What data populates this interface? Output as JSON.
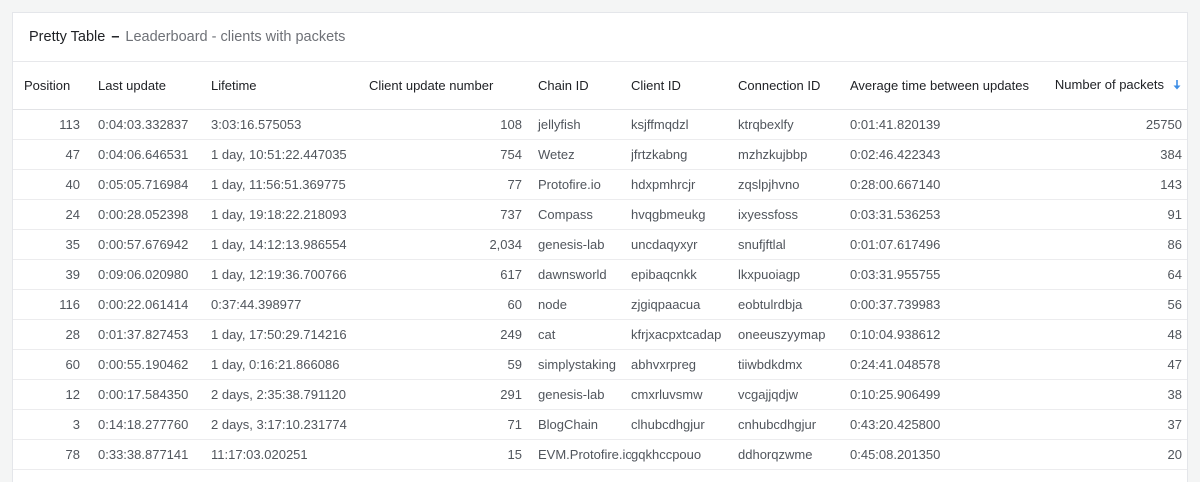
{
  "panel": {
    "title": "Pretty Table",
    "separator": "–",
    "description": "Leaderboard - clients with packets"
  },
  "table": {
    "columns": [
      {
        "key": "position",
        "label": "Position"
      },
      {
        "key": "last_update",
        "label": "Last update"
      },
      {
        "key": "lifetime",
        "label": "Lifetime"
      },
      {
        "key": "client_update_number",
        "label": "Client update number"
      },
      {
        "key": "chain_id",
        "label": "Chain ID"
      },
      {
        "key": "client_id",
        "label": "Client ID"
      },
      {
        "key": "connection_id",
        "label": "Connection ID"
      },
      {
        "key": "avg_time",
        "label": "Average time between updates"
      },
      {
        "key": "packets",
        "label": "Number of packets"
      }
    ],
    "sort": {
      "column": "packets",
      "direction": "descending",
      "icon": "sort-descending-icon",
      "color": "#3d8ee6"
    },
    "rows": [
      {
        "position": "113",
        "last_update": "0:04:03.332837",
        "lifetime": "3:03:16.575053",
        "client_update_number": "108",
        "chain_id": "jellyfish",
        "client_id": "ksjffmqdzl",
        "connection_id": "ktrqbexlfy",
        "avg_time": "0:01:41.820139",
        "packets": "25750"
      },
      {
        "position": "47",
        "last_update": "0:04:06.646531",
        "lifetime": "1 day, 10:51:22.447035",
        "client_update_number": "754",
        "chain_id": "Wetez",
        "client_id": "jfrtzkabng",
        "connection_id": "mzhzkujbbp",
        "avg_time": "0:02:46.422343",
        "packets": "384"
      },
      {
        "position": "40",
        "last_update": "0:05:05.716984",
        "lifetime": "1 day, 11:56:51.369775",
        "client_update_number": "77",
        "chain_id": "Protofire.io",
        "client_id": "hdxpmhrcjr",
        "connection_id": "zqslpjhvno",
        "avg_time": "0:28:00.667140",
        "packets": "143"
      },
      {
        "position": "24",
        "last_update": "0:00:28.052398",
        "lifetime": "1 day, 19:18:22.218093",
        "client_update_number": "737",
        "chain_id": "Compass",
        "client_id": "hvqgbmeukg",
        "connection_id": "ixyessfoss",
        "avg_time": "0:03:31.536253",
        "packets": "91"
      },
      {
        "position": "35",
        "last_update": "0:00:57.676942",
        "lifetime": "1 day, 14:12:13.986554",
        "client_update_number": "2,034",
        "chain_id": "genesis-lab",
        "client_id": "uncdaqyxyr",
        "connection_id": "snufjftlal",
        "avg_time": "0:01:07.617496",
        "packets": "86"
      },
      {
        "position": "39",
        "last_update": "0:09:06.020980",
        "lifetime": "1 day, 12:19:36.700766",
        "client_update_number": "617",
        "chain_id": "dawnsworld",
        "client_id": "epibaqcnkk",
        "connection_id": "lkxpuoiagp",
        "avg_time": "0:03:31.955755",
        "packets": "64"
      },
      {
        "position": "116",
        "last_update": "0:00:22.061414",
        "lifetime": "0:37:44.398977",
        "client_update_number": "60",
        "chain_id": "node",
        "client_id": "zjgiqpaacua",
        "connection_id": "eobtulrdbja",
        "avg_time": "0:00:37.739983",
        "packets": "56"
      },
      {
        "position": "28",
        "last_update": "0:01:37.827453",
        "lifetime": "1 day, 17:50:29.714216",
        "client_update_number": "249",
        "chain_id": "cat",
        "client_id": "kfrjxacpxtcadap",
        "connection_id": "oneeuszyymap",
        "avg_time": "0:10:04.938612",
        "packets": "48"
      },
      {
        "position": "60",
        "last_update": "0:00:55.190462",
        "lifetime": "1 day, 0:16:21.866086",
        "client_update_number": "59",
        "chain_id": "simplystaking",
        "client_id": "abhvxrpreg",
        "connection_id": "tiiwbdkdmx",
        "avg_time": "0:24:41.048578",
        "packets": "47"
      },
      {
        "position": "12",
        "last_update": "0:00:17.584350",
        "lifetime": "2 days, 2:35:38.791120",
        "client_update_number": "291",
        "chain_id": "genesis-lab",
        "client_id": "cmxrluvsmw",
        "connection_id": "vcgajjqdjw",
        "avg_time": "0:10:25.906499",
        "packets": "38"
      },
      {
        "position": "3",
        "last_update": "0:14:18.277760",
        "lifetime": "2 days, 3:17:10.231774",
        "client_update_number": "71",
        "chain_id": "BlogChain",
        "client_id": "clhubcdhgjur",
        "connection_id": "cnhubcdhgjur",
        "avg_time": "0:43:20.425800",
        "packets": "37"
      },
      {
        "position": "78",
        "last_update": "0:33:38.877141",
        "lifetime": "11:17:03.020251",
        "client_update_number": "15",
        "chain_id": "EVM.Protofire.io",
        "client_id": "gqkhccpouo",
        "connection_id": "ddhorqzwme",
        "avg_time": "0:45:08.201350",
        "packets": "20"
      }
    ]
  }
}
